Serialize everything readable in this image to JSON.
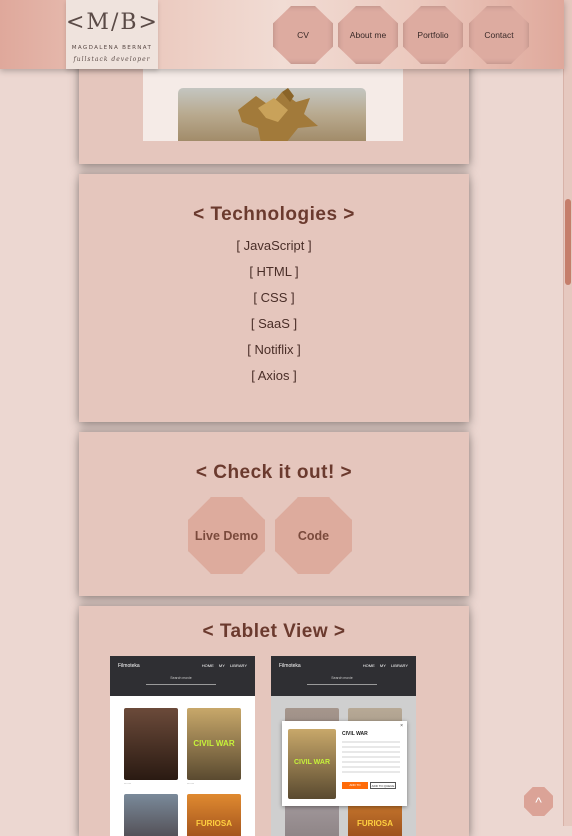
{
  "colors": {
    "accent": "#6b3a2e",
    "card": "#e5c6bd",
    "button": "#ddab9d",
    "page": "#ecd7d1"
  },
  "header": {
    "logo": {
      "mark": "<M/B>",
      "name": "MAGDALENA BERNAT",
      "subtitle": "fullstack developer"
    },
    "nav": {
      "cv": "CV",
      "about": "About me",
      "portfolio": "Portfolio",
      "contact": "Contact"
    }
  },
  "gallery": {
    "image_icon": "statue-image"
  },
  "technologies": {
    "title": "< Technologies >",
    "items": [
      "[ JavaScript ]",
      "[ HTML ]",
      "[ CSS ]",
      "[ SaaS ]",
      "[ Notiflix ]",
      "[ Axios ]"
    ]
  },
  "check": {
    "title": "< Check it out! >",
    "live_demo": "Live Demo",
    "code": "Code"
  },
  "tablet": {
    "title": "< Tablet View >",
    "left": {
      "brand": "Filmoteka",
      "nav": "HOME MY LIBRARY",
      "search": "Search movie",
      "posters": [
        "CIVIL WAR",
        "FURIOSA"
      ]
    },
    "right": {
      "brand": "Filmoteka",
      "nav": "HOME MY LIBRARY",
      "search": "Search movie",
      "posters": [
        "CIVIL WAR",
        "FURIOSA"
      ],
      "modal": {
        "title": "CIVIL WAR",
        "poster": "CIVIL WAR",
        "close": "×",
        "watched": "ADD TO WATCHED",
        "queue": "ADD TO QUEUE"
      }
    }
  },
  "scroll_top": {
    "label": "^"
  }
}
